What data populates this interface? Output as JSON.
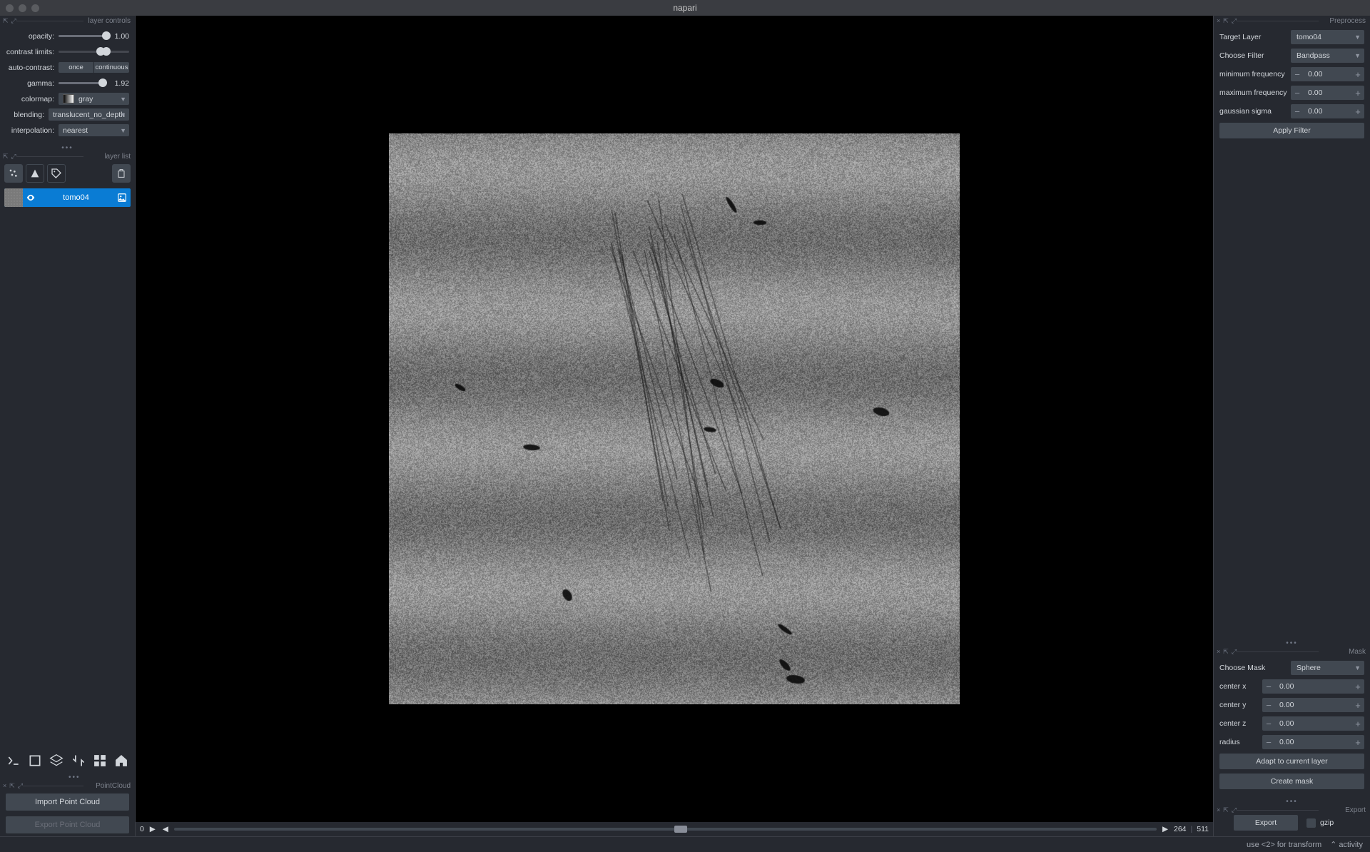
{
  "app_title": "napari",
  "layer_controls": {
    "title": "layer controls",
    "opacity_label": "opacity:",
    "opacity_value": "1.00",
    "contrast_label": "contrast limits:",
    "auto_contrast_label": "auto-contrast:",
    "once_btn": "once",
    "continuous_btn": "continuous",
    "gamma_label": "gamma:",
    "gamma_value": "1.92",
    "colormap_label": "colormap:",
    "colormap_value": "gray",
    "blending_label": "blending:",
    "blending_value": "translucent_no_depth",
    "interpolation_label": "interpolation:",
    "interpolation_value": "nearest"
  },
  "layer_list": {
    "title": "layer list",
    "items": [
      {
        "name": "tomo04"
      }
    ]
  },
  "point_cloud": {
    "title": "PointCloud",
    "import_btn": "Import Point Cloud",
    "export_btn": "Export Point Cloud"
  },
  "dims": {
    "axis": "0",
    "current": "264",
    "max": "511"
  },
  "status": {
    "hint": "use <2> for transform",
    "activity": "activity"
  },
  "preprocess": {
    "title": "Preprocess",
    "target_label": "Target Layer",
    "target_value": "tomo04",
    "filter_label": "Choose Filter",
    "filter_value": "Bandpass",
    "min_freq_label": "minimum frequency",
    "min_freq_value": "0.00",
    "max_freq_label": "maximum frequency",
    "max_freq_value": "0.00",
    "sigma_label": "gaussian sigma",
    "sigma_value": "0.00",
    "apply_btn": "Apply Filter"
  },
  "mask": {
    "title": "Mask",
    "choose_label": "Choose Mask",
    "choose_value": "Sphere",
    "cx_label": "center x",
    "cx_value": "0.00",
    "cy_label": "center y",
    "cy_value": "0.00",
    "cz_label": "center z",
    "cz_value": "0.00",
    "r_label": "radius",
    "r_value": "0.00",
    "adapt_btn": "Adapt to current layer",
    "create_btn": "Create mask"
  },
  "export": {
    "title": "Export",
    "btn": "Export",
    "gzip_label": "gzip"
  }
}
